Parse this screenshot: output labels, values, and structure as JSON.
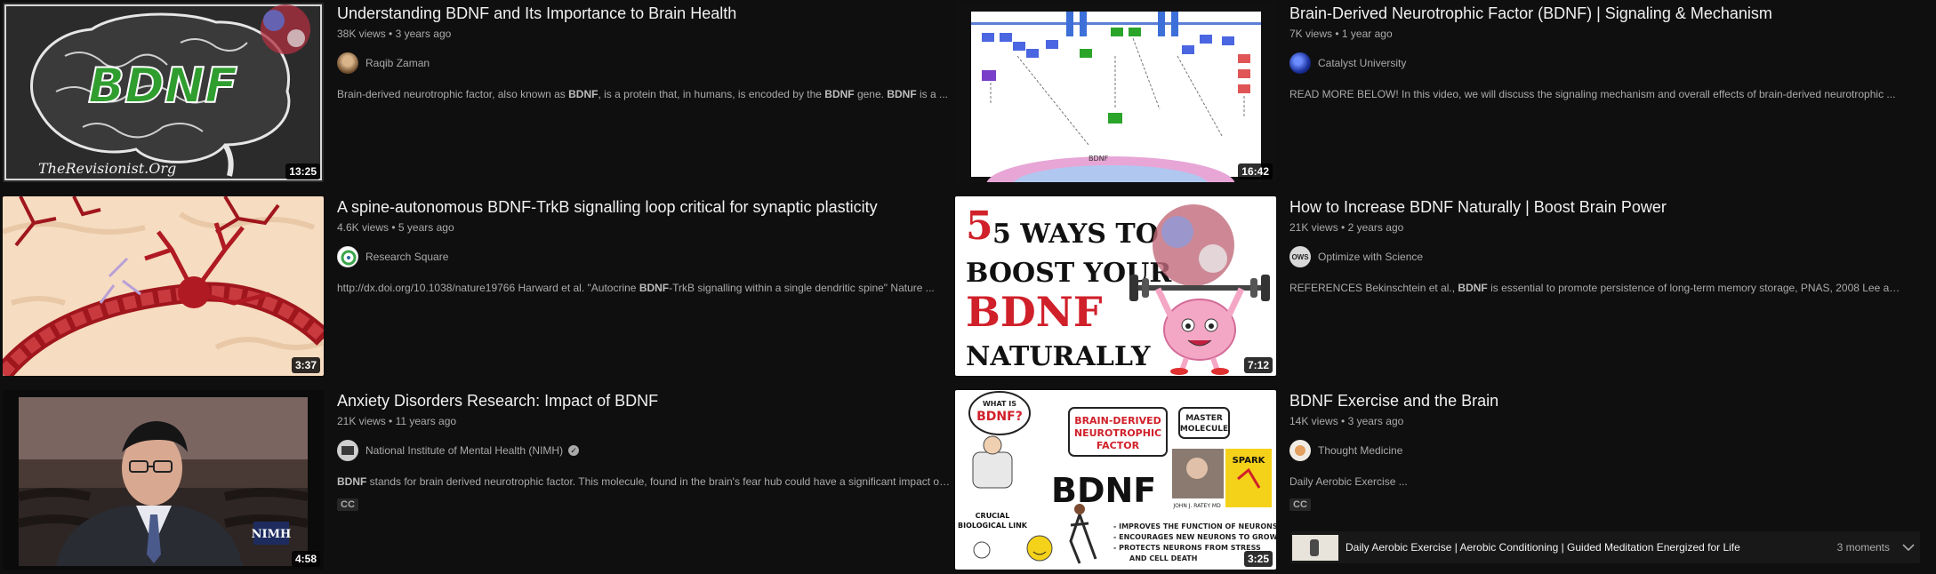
{
  "videos": [
    {
      "title": "Understanding BDNF and Its Importance to Brain Health",
      "views": "38K views",
      "age": "3 years ago",
      "channel": "Raqib Zaman",
      "desc_parts": [
        "Brain-derived neurotrophic factor, also known as ",
        "BDNF",
        ", is a protein that, in humans, is encoded by the ",
        "BDNF",
        " gene. ",
        "BDNF",
        " is a ..."
      ],
      "duration": "13:25",
      "thumb_text": "BDNF",
      "thumb_caption": "TheRevisionist.Org"
    },
    {
      "title": "Brain-Derived Neurotrophic Factor (BDNF) | Signaling & Mechanism",
      "views": "7K views",
      "age": "1 year ago",
      "channel": "Catalyst University",
      "desc_parts": [
        "READ MORE BELOW! In this video, we will discuss the signaling mechanism and overall effects of brain-derived neurotrophic ..."
      ],
      "duration": "16:42"
    },
    {
      "title": "A spine-autonomous BDNF-TrkB signalling loop critical for synaptic plasticity",
      "views": "4.6K views",
      "age": "5 years ago",
      "channel": "Research Square",
      "desc_parts": [
        "http://dx.doi.org/10.1038/nature19766 Harward et al. \"Autocrine ",
        "BDNF",
        "-TrkB signalling within a single dendritic spine\" Nature ..."
      ],
      "duration": "3:37"
    },
    {
      "title": "How to Increase BDNF Naturally | Boost Brain Power",
      "views": "21K views",
      "age": "2 years ago",
      "channel": "Optimize with Science",
      "desc_parts": [
        "REFERENCES Bekinschtein et al., ",
        "BDNF",
        " is essential to promote persistence of long-term memory storage, PNAS, 2008 Lee and ..."
      ],
      "duration": "7:12",
      "thumb_lines": [
        "5 WAYS TO",
        "BOOST YOUR",
        "BDNF",
        "NATURALLY"
      ]
    },
    {
      "title": "Anxiety Disorders Research: Impact of BDNF",
      "views": "21K views",
      "age": "11 years ago",
      "channel": "National Institute of Mental Health (NIMH)",
      "desc_parts": [
        "BDNF",
        " stands for brain derived neurotrophic factor. This molecule, found in the brain's fear hub could have a significant impact on ..."
      ],
      "duration": "4:58",
      "badge": "CC",
      "thumb_logo": "NIMH"
    },
    {
      "title": "BDNF Exercise and the Brain",
      "views": "14K views",
      "age": "3 years ago",
      "channel": "Thought Medicine",
      "desc_parts": [
        "Daily Aerobic Exercise ..."
      ],
      "duration": "3:25",
      "badge": "CC",
      "thumb_labels": {
        "what_is": "WHAT IS",
        "q": "BDNF?",
        "big": "BRAIN-DERIVED NEUROTROPHIC FACTOR",
        "master": "MASTER MOLECULE",
        "bdnf": "BDNF",
        "spark": "SPARK",
        "crucial": "CRUCIAL BIOLOGICAL LINK",
        "author": "JOHN J. RATEY MD",
        "b1": "- IMPROVES THE FUNCTION OF NEURONS",
        "b2": "- ENCOURAGES NEW NEURONS TO GROW",
        "b3": "- PROTECTS NEURONS FROM STRESS",
        "b4": "AND CELL DEATH"
      }
    }
  ],
  "moments": {
    "title": "Daily Aerobic Exercise | Aerobic Conditioning | Guided Meditation Energized for Life",
    "count": "3 moments"
  },
  "icons": {
    "verified": "verified-check-icon",
    "chevron": "chevron-down-icon"
  }
}
